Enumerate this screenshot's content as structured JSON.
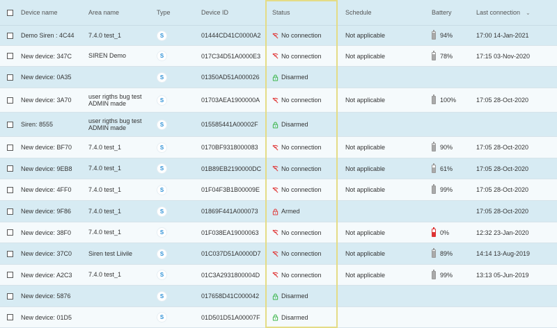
{
  "columns": {
    "device_name": "Device name",
    "area_name": "Area name",
    "type": "Type",
    "device_id": "Device ID",
    "status": "Status",
    "schedule": "Schedule",
    "battery": "Battery",
    "last_connection": "Last connection"
  },
  "colors": {
    "accent": "#2a8fd6",
    "no_connection": "#e03a3a",
    "disarmed": "#3bb54a",
    "armed": "#e03a3a",
    "highlight": "#e4dc86"
  },
  "rows": [
    {
      "name": "Demo Siren : 4C44",
      "area": "7.4.0 test_1",
      "type": "S",
      "id": "01444CD41C0000A2",
      "status": "No connection",
      "status_kind": "no_connection",
      "schedule": "Not applicable",
      "battery": "94%",
      "battery_level": 0.94,
      "last": "17:00 14-Jan-2021"
    },
    {
      "name": "New device: 347C",
      "area": "SIREN Demo",
      "type": "S",
      "id": "017C34D51A0000E3",
      "status": "No connection",
      "status_kind": "no_connection",
      "schedule": "Not applicable",
      "battery": "78%",
      "battery_level": 0.78,
      "last": "17:15 03-Nov-2020"
    },
    {
      "name": "New device: 0A35",
      "area": "",
      "type": "S",
      "id": "01350AD51A000026",
      "status": "Disarmed",
      "status_kind": "disarmed",
      "schedule": "",
      "battery": "",
      "battery_level": null,
      "last": ""
    },
    {
      "name": "New device: 3A70",
      "area": "user rigths bug test ADMIN made",
      "type": "S",
      "id": "01703AEA1900000A",
      "status": "No connection",
      "status_kind": "no_connection",
      "schedule": "Not applicable",
      "battery": "100%",
      "battery_level": 1.0,
      "last": "17:05 28-Oct-2020"
    },
    {
      "name": "Siren: 8555",
      "area": "user rigths bug test ADMIN made",
      "type": "S",
      "id": "015585441A00002F",
      "status": "Disarmed",
      "status_kind": "disarmed",
      "schedule": "",
      "battery": "",
      "battery_level": null,
      "last": ""
    },
    {
      "name": "New device: BF70",
      "area": "7.4.0 test_1",
      "type": "S",
      "id": "0170BF9318000083",
      "status": "No connection",
      "status_kind": "no_connection",
      "schedule": "Not applicable",
      "battery": "90%",
      "battery_level": 0.9,
      "last": "17:05 28-Oct-2020"
    },
    {
      "name": "New device: 9EB8",
      "area": "7.4.0 test_1",
      "type": "S",
      "id": "01B89EB2190000DC",
      "status": "No connection",
      "status_kind": "no_connection",
      "schedule": "Not applicable",
      "battery": "61%",
      "battery_level": 0.61,
      "last": "17:05 28-Oct-2020"
    },
    {
      "name": "New device: 4FF0",
      "area": "7.4.0 test_1",
      "type": "S",
      "id": "01F04F3B1B00009E",
      "status": "No connection",
      "status_kind": "no_connection",
      "schedule": "Not applicable",
      "battery": "99%",
      "battery_level": 0.99,
      "last": "17:05 28-Oct-2020"
    },
    {
      "name": "New device: 9F86",
      "area": "7.4.0 test_1",
      "type": "S",
      "id": "01869F441A000073",
      "status": "Armed",
      "status_kind": "armed",
      "schedule": "",
      "battery": "",
      "battery_level": null,
      "last": "17:05 28-Oct-2020"
    },
    {
      "name": "New device: 38F0",
      "area": "7.4.0 test_1",
      "type": "S",
      "id": "01F038EA19000063",
      "status": "No connection",
      "status_kind": "no_connection",
      "schedule": "Not applicable",
      "battery": "0%",
      "battery_level": 0.0,
      "battery_low": true,
      "last": "12:32 23-Jan-2020"
    },
    {
      "name": "New device: 37C0",
      "area": "Siren test Liivile",
      "type": "S",
      "id": "01C037D51A0000D7",
      "status": "No connection",
      "status_kind": "no_connection",
      "schedule": "Not applicable",
      "battery": "89%",
      "battery_level": 0.89,
      "last": "14:14 13-Aug-2019"
    },
    {
      "name": "New device: A2C3",
      "area": "7.4.0 test_1",
      "type": "S",
      "id": "01C3A2931800004D",
      "status": "No connection",
      "status_kind": "no_connection",
      "schedule": "Not applicable",
      "battery": "99%",
      "battery_level": 0.99,
      "last": "13:13 05-Jun-2019"
    },
    {
      "name": "New device: 5876",
      "area": "",
      "type": "S",
      "id": "017658D41C000042",
      "status": "Disarmed",
      "status_kind": "disarmed",
      "schedule": "",
      "battery": "",
      "battery_level": null,
      "last": ""
    },
    {
      "name": "New device: 01D5",
      "area": "",
      "type": "S",
      "id": "01D501D51A00007F",
      "status": "Disarmed",
      "status_kind": "disarmed",
      "schedule": "",
      "battery": "",
      "battery_level": null,
      "last": ""
    }
  ]
}
